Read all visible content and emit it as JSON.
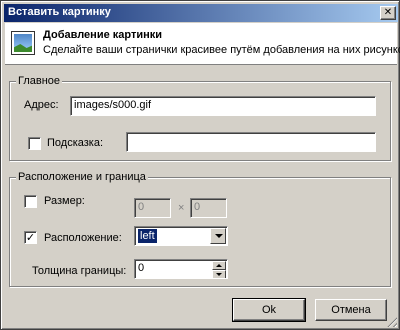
{
  "window": {
    "title": "Вставить картинку",
    "close_glyph": "✕"
  },
  "header": {
    "title": "Добавление картинки",
    "subtitle": "Сделайте ваши странички красивее путём добавления на них рисунков!",
    "icon": "picture-icon"
  },
  "main_group": {
    "legend": "Главное",
    "address_label": "Адрес:",
    "address_value": "images/s000.gif",
    "hint_label": "Подсказка:",
    "hint_checked": false,
    "hint_value": ""
  },
  "layout_group": {
    "legend": "Расположение и граница",
    "size_label": "Размер:",
    "size_checked": false,
    "width_value": "0",
    "times_glyph": "×",
    "height_value": "0",
    "align_label": "Расположение:",
    "align_checked": true,
    "align_value": "left",
    "border_label": "Толщина границы:",
    "border_value": "0",
    "check_glyph": "✓"
  },
  "buttons": {
    "ok": "Ok",
    "cancel": "Отмена"
  },
  "colors": {
    "titlebar_start": "#0a246a",
    "titlebar_end": "#a6caf0",
    "face": "#d4d0c8"
  }
}
